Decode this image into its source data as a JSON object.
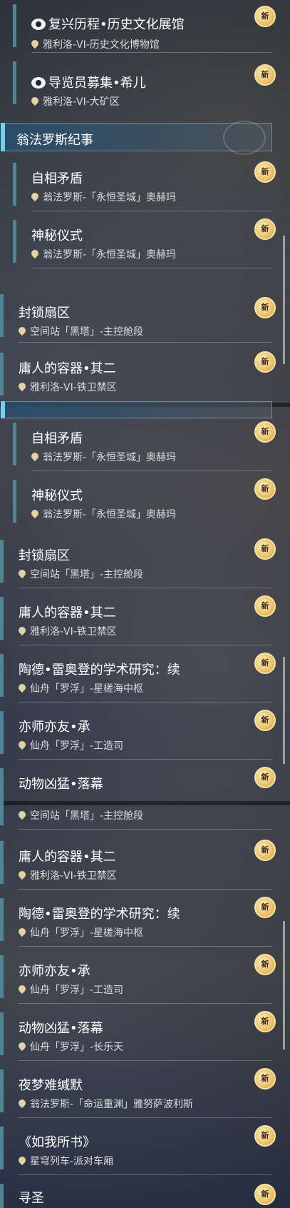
{
  "badge": {
    "label": "新",
    "star": "✦"
  },
  "panels": [
    {
      "top": 0,
      "section": null,
      "items": [
        {
          "name": "复兴历程•历史文化展馆",
          "loc": "雅利洛-VI-历史文化博物馆",
          "level": 2,
          "icon": "mission-icon"
        },
        {
          "name": "导览员募集•希儿",
          "loc": "雅利洛-VI-大矿区",
          "level": 2,
          "icon": "mission-icon"
        }
      ]
    }
  ],
  "section_title": "翁法罗斯纪事",
  "group_a": [
    {
      "name": "自相矛盾",
      "loc": "翁法罗斯-「永恒圣城」奥赫玛"
    },
    {
      "name": "神秘仪式",
      "loc": "翁法罗斯-「永恒圣城」奥赫玛"
    }
  ],
  "group_b": [
    {
      "name": "封锁扇区",
      "loc": "空间站「黑塔」-主控舱段"
    },
    {
      "name": "庸人的容器•其二",
      "loc": "雅利洛-VI-铁卫禁区"
    }
  ],
  "group_c_sub": [
    {
      "name": "自相矛盾",
      "loc": "翁法罗斯-「永恒圣城」奥赫玛"
    },
    {
      "name": "神秘仪式",
      "loc": "翁法罗斯-「永恒圣城」奥赫玛"
    }
  ],
  "group_c": [
    {
      "name": "封锁扇区",
      "loc": "空间站「黑塔」-主控舱段"
    },
    {
      "name": "庸人的容器•其二",
      "loc": "雅利洛-VI-铁卫禁区"
    },
    {
      "name": "陶德•雷奥登的学术研究：续",
      "loc": "仙舟「罗浮」-星槎海中枢"
    },
    {
      "name": "亦师亦友•承",
      "loc": "仙舟「罗浮」-工造司"
    },
    {
      "name": "动物凶猛•落幕",
      "loc": ""
    }
  ],
  "group_d": [
    {
      "name": "",
      "loc": "空间站「黑塔」-主控舱段"
    },
    {
      "name": "庸人的容器•其二",
      "loc": "雅利洛-VI-铁卫禁区"
    },
    {
      "name": "陶德•雷奥登的学术研究：续",
      "loc": "仙舟「罗浮」-星槎海中枢"
    },
    {
      "name": "亦师亦友•承",
      "loc": "仙舟「罗浮」-工造司"
    },
    {
      "name": "动物凶猛•落幕",
      "loc": "仙舟「罗浮」-长乐天"
    },
    {
      "name": "夜梦难缄默",
      "loc": "翁法罗斯-「命运重渊」雅努萨波利斯"
    },
    {
      "name": "《如我所书》",
      "loc": "星穹列车-派对车厢"
    },
    {
      "name": "寻圣",
      "loc": ""
    }
  ]
}
